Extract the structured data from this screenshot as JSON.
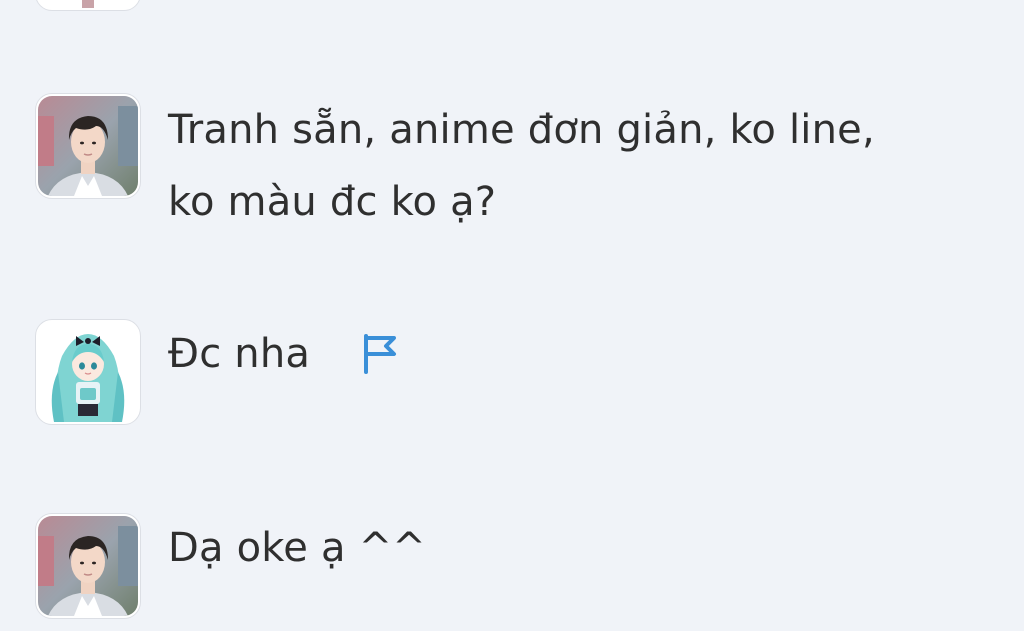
{
  "messages": [
    {
      "sender": "user",
      "line1": "Tranh sẵn, anime đơn giản, ko line,",
      "line2": "ko màu đc ko ạ?"
    },
    {
      "sender": "artist",
      "text": "Đc nha",
      "icon": "flag-icon"
    },
    {
      "sender": "user",
      "text": "Dạ oke ạ ^^"
    }
  ],
  "colors": {
    "background": "#f0f3f8",
    "text": "#2f2f2f",
    "flag": "#3a8fd8"
  }
}
